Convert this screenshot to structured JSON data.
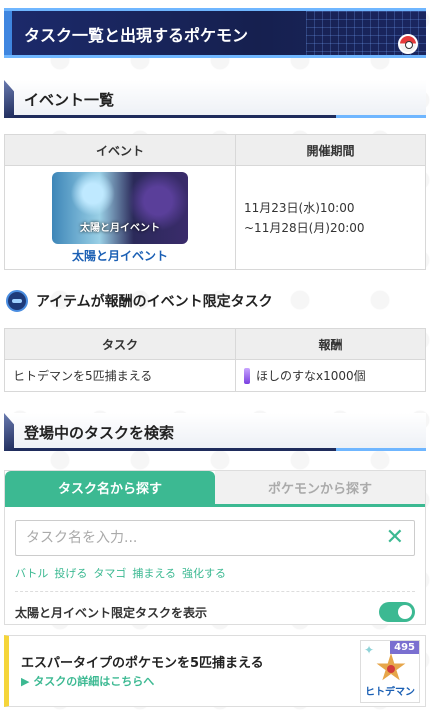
{
  "banner": {
    "title": "タスク一覧と出現するポケモン"
  },
  "event_section": {
    "header": "イベント一覧",
    "columns": [
      "イベント",
      "開催期間"
    ],
    "row": {
      "image_title": "太陽と月イベント",
      "link": "太陽と月イベント",
      "period_start": "11月23日(水)10:00",
      "period_end": "~11月28日(月)20:00"
    }
  },
  "task_section": {
    "heading": "アイテムが報酬のイベント限定タスク",
    "columns": [
      "タスク",
      "報酬"
    ],
    "rows": [
      {
        "task": "ヒトデマンを5匹捕まえる",
        "reward": "ほしのすなx1000個"
      }
    ]
  },
  "search_section": {
    "header": "登場中のタスクを検索",
    "tabs": [
      "タスク名から探す",
      "ポケモンから探す"
    ],
    "placeholder": "タスク名を入力...",
    "tags": [
      "バトル",
      "投げる",
      "タマゴ",
      "捕まえる",
      "強化する"
    ],
    "toggle_label": "太陽と月イベント限定タスクを表示",
    "toggle_on": true
  },
  "task_card": {
    "title": "エスパータイプのポケモンを5匹捕まえる",
    "detail_link": "▶ タスクの詳細はこちらへ",
    "pokemon_name": "ヒトデマン",
    "cp": "495"
  },
  "colors": {
    "accent_green": "#3cb992",
    "banner_navy": "#1c2a6b",
    "link_blue": "#1a5fb4",
    "card_accent_yellow": "#f5d53a"
  }
}
